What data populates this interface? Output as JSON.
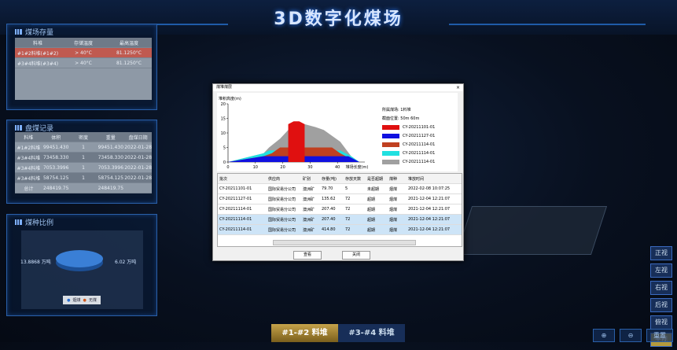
{
  "title": "3D数字化煤场",
  "panels": {
    "storage": {
      "title": "煤场存量",
      "headers": [
        "料堆",
        "存储温度",
        "最高温度"
      ],
      "rows": [
        [
          "#1#2料堆(#1#2)",
          "> 40°C",
          "81.1250°C"
        ],
        [
          "#3#4料堆(#3#4)",
          "> 40°C",
          "81.1250°C"
        ]
      ]
    },
    "inventory": {
      "title": "盘煤记录",
      "headers": [
        "料堆",
        "体积",
        "密度",
        "重量",
        "盘煤日期"
      ],
      "rows": [
        [
          "#1#2料堆",
          "99451.430",
          "1",
          "99451.430",
          "2022-01-28"
        ],
        [
          "#3#4料堆",
          "73458.330",
          "1",
          "73458.330",
          "2022-01-28"
        ],
        [
          "#3#4料堆",
          "7053.3996",
          "1",
          "7053.3996",
          "2022-01-28"
        ],
        [
          "#3#4料堆",
          "58754.125",
          "1",
          "58754.125",
          "2022-01-28"
        ],
        [
          "总计",
          "248419.75",
          "",
          "248419.75",
          ""
        ]
      ]
    },
    "ratio": {
      "title": "煤种比例",
      "left_value": "13.8868 万吨",
      "right_value": "6.02 万吨",
      "legend": [
        "烟煤",
        "无煤"
      ]
    }
  },
  "view_buttons": [
    "正视",
    "左视",
    "右视",
    "后视",
    "俯视",
    "平视"
  ],
  "active_view": "平视",
  "tabs": [
    "#1-#2 料堆",
    "#3-#4 料堆"
  ],
  "zoom_labels": [
    "⊕",
    "⊖",
    "重置"
  ],
  "dialog": {
    "title": "煤堆煤层",
    "close": "×",
    "ylabel": "堆积高度(m)",
    "xlabel": "堆场长度(m)",
    "legend_header1": "所属煤场:  1料堆",
    "legend_header2": "截面位置:  50m  60m",
    "layers": [
      {
        "name": "CY-20211101-01",
        "color": "#e01010"
      },
      {
        "name": "CY-20211127-01",
        "color": "#1010e0"
      },
      {
        "name": "CY-20211114-01",
        "color": "#c04020"
      },
      {
        "name": "CY-20211114-01",
        "color": "#20e0e0"
      },
      {
        "name": "CY-20211114-01",
        "color": "#a0a0a0"
      }
    ],
    "grid_headers": [
      "批次",
      "供应商",
      "矿别",
      "存量(吨)",
      "存放天数",
      "是否超期",
      "煤种",
      "堆放时间"
    ],
    "grid_rows": [
      [
        "CY-20211101-01",
        "国际贸易分公司",
        "澳洲矿",
        "79.70",
        "5",
        "未超期",
        "烟煤",
        "2022-02-08 10:07:25"
      ],
      [
        "CY-20211127-01",
        "国际贸易分公司",
        "澳洲矿",
        "135.62",
        "72",
        "超期",
        "烟煤",
        "2021-12-04 12:21:07"
      ],
      [
        "CY-20211114-01",
        "国际贸易分公司",
        "澳洲矿",
        "207.40",
        "72",
        "超期",
        "烟煤",
        "2021-12-04 12:21:07"
      ],
      [
        "CY-20211114-01",
        "国际贸易分公司",
        "澳洲矿",
        "207.40",
        "72",
        "超期",
        "烟煤",
        "2021-12-04 12:21:07"
      ],
      [
        "CY-20211114-01",
        "国际贸易分公司",
        "澳洲矿",
        "414.80",
        "72",
        "超期",
        "烟煤",
        "2021-12-04 12:21:07"
      ]
    ],
    "ok": "查看",
    "cancel": "关闭"
  },
  "chart_data": {
    "type": "area",
    "xlabel": "堆场长度(m)",
    "ylabel": "堆积高度(m)",
    "xlim": [
      0,
      50
    ],
    "ylim": [
      0,
      20
    ],
    "xticks": [
      0,
      10,
      20,
      30,
      40
    ],
    "yticks": [
      0,
      5,
      10,
      15,
      20
    ],
    "series": [
      {
        "name": "CY-20211114-01",
        "color": "#a0a0a0",
        "x": [
          0,
          13,
          15,
          19,
          22,
          24,
          28,
          32,
          35,
          41,
          45,
          48
        ],
        "y": [
          0,
          3,
          5,
          8,
          11,
          13,
          13,
          12,
          11,
          7,
          2,
          0
        ]
      },
      {
        "name": "CY-20211114-01",
        "color": "#20e0e0",
        "x": [
          0,
          13,
          15,
          41,
          45,
          48
        ],
        "y": [
          0,
          3,
          4,
          4,
          2,
          0
        ]
      },
      {
        "name": "CY-20211114-01",
        "color": "#c04020",
        "x": [
          0,
          13,
          16,
          19,
          38,
          41,
          45,
          48
        ],
        "y": [
          0,
          2,
          3,
          5,
          5,
          3,
          1,
          0
        ]
      },
      {
        "name": "CY-20211127-01",
        "color": "#1010e0",
        "x": [
          0,
          13,
          15,
          44,
          48
        ],
        "y": [
          0,
          2,
          2,
          2,
          0
        ]
      },
      {
        "name": "CY-20211101-01",
        "color": "#e01010",
        "x": [
          22,
          24,
          26,
          28
        ],
        "y": [
          13,
          14,
          14,
          13
        ]
      }
    ]
  }
}
